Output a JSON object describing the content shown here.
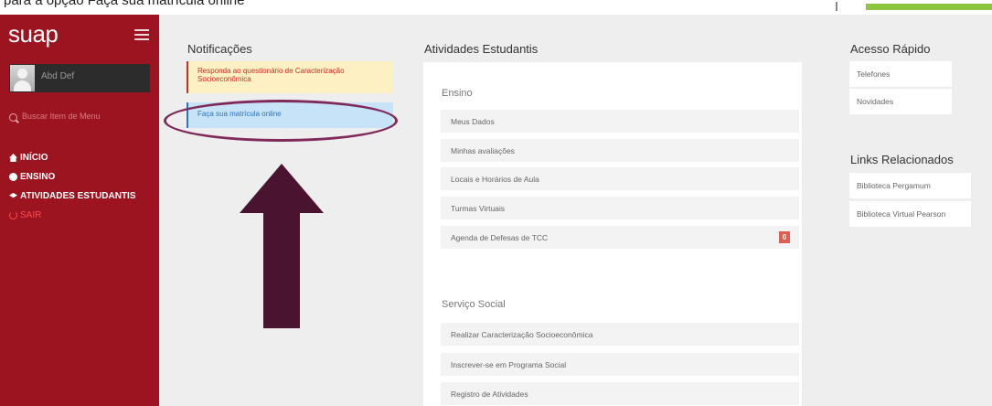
{
  "caption": "para a opção Faça sua matrícula online",
  "sidebar": {
    "brand": "suap",
    "user_name": "Abd Def",
    "search_placeholder": "Buscar Item de Menu",
    "nav": [
      {
        "label": "INÍCIO",
        "icon": "home-icon"
      },
      {
        "label": "ENSINO",
        "icon": "ensino-icon"
      },
      {
        "label": "ATIVIDADES ESTUDANTIS",
        "icon": "graduation-cap-icon"
      },
      {
        "label": "SAIR",
        "icon": "power-icon"
      }
    ]
  },
  "notifications": {
    "title": "Notificações",
    "items": [
      {
        "text": "Responda ao questionário de Caracterização Socioeconômica",
        "style": "warning"
      },
      {
        "text": "Faça sua matrícula online",
        "style": "info"
      }
    ]
  },
  "atividades": {
    "title": "Atividades Estudantis",
    "groups": [
      {
        "title": "Ensino",
        "items": [
          {
            "label": "Meus Dados"
          },
          {
            "label": "Minhas avaliações"
          },
          {
            "label": "Locais e Horários de Aula"
          },
          {
            "label": "Turmas Virtuais"
          },
          {
            "label": "Agenda de Defesas de TCC",
            "badge": "0"
          }
        ]
      },
      {
        "title": "Serviço Social",
        "items": [
          {
            "label": "Realizar Caracterização Socioeconômica"
          },
          {
            "label": "Inscrever-se em Programa Social"
          },
          {
            "label": "Registro de Atividades"
          }
        ]
      }
    ]
  },
  "acesso_rapido": {
    "title": "Acesso Rápido",
    "items": [
      "Telefones",
      "Novidades"
    ]
  },
  "links_relacionados": {
    "title": "Links Relacionados",
    "items": [
      "Biblioteca Pergamum",
      "Biblioteca Virtual Pearson"
    ]
  },
  "colors": {
    "sidebar": "#9d1421",
    "annotation": "#7f2a5b",
    "arrow": "#4a1430",
    "warning_text": "#cf2c28",
    "info_text": "#2d73b7"
  }
}
